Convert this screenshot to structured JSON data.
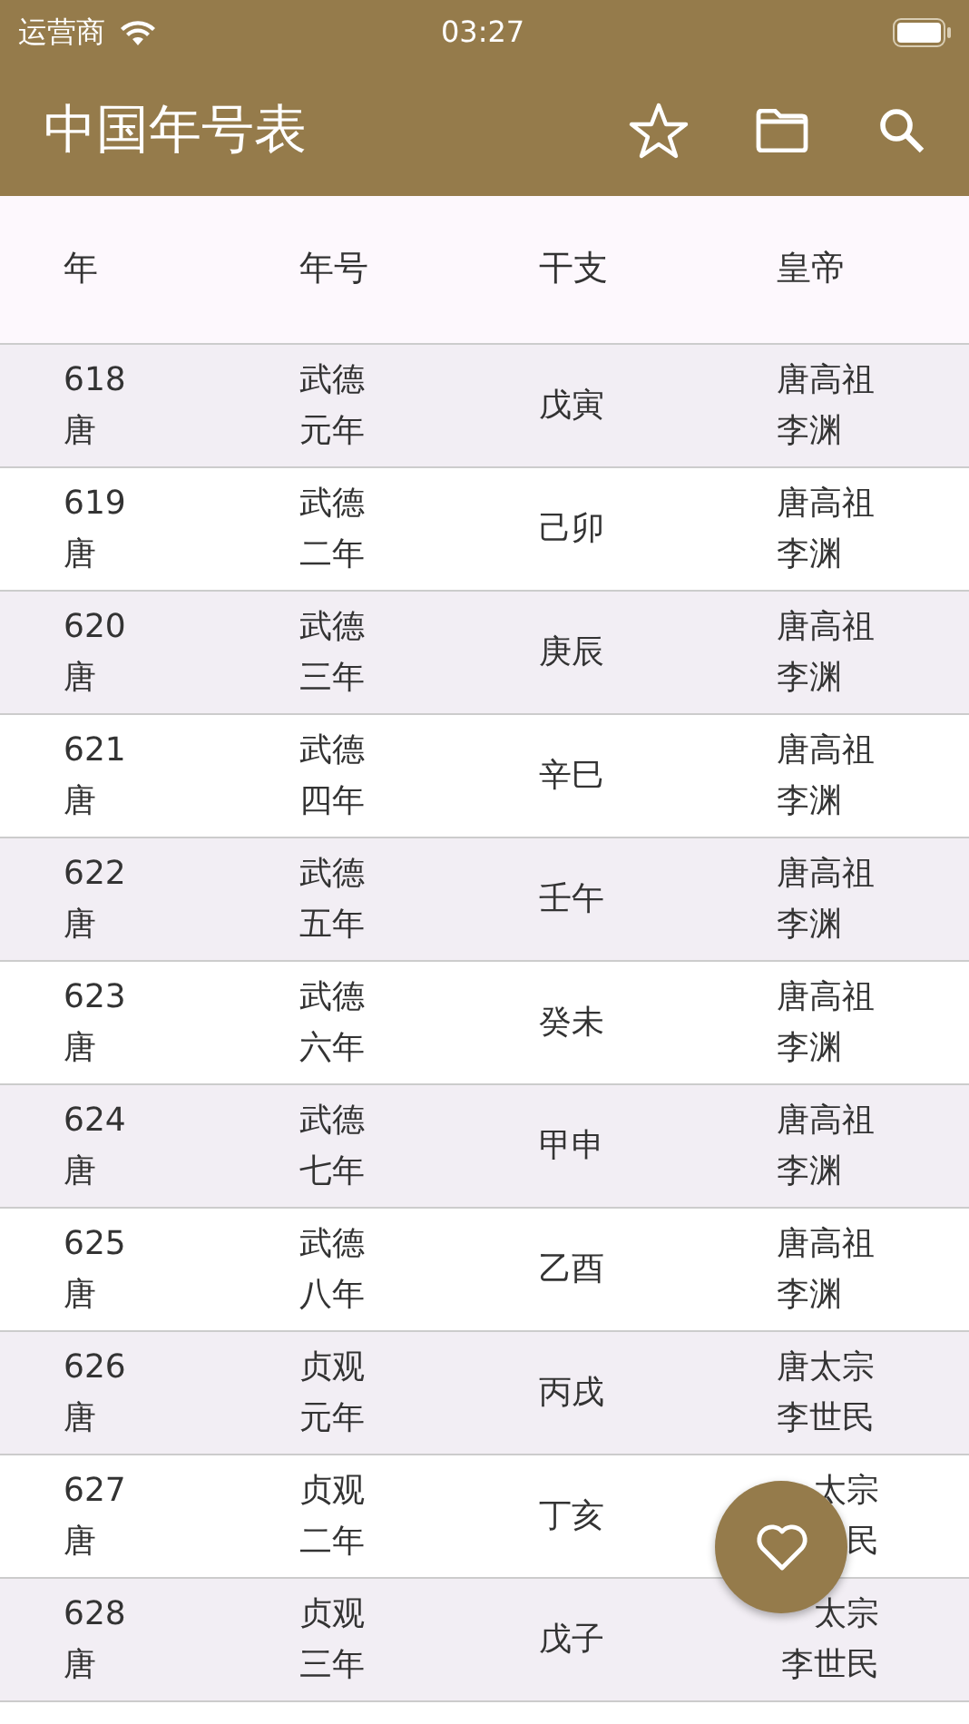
{
  "status_bar": {
    "carrier": "运营商",
    "time": "03:27"
  },
  "app_bar": {
    "title": "中国年号表"
  },
  "table": {
    "columns": [
      "年",
      "年号",
      "干支",
      "皇帝"
    ],
    "rows": [
      {
        "year": "618",
        "dynasty": "唐",
        "era": [
          "武德",
          "元年"
        ],
        "ganzhi": "戊寅",
        "emperor": [
          "唐高祖",
          "李渊"
        ]
      },
      {
        "year": "619",
        "dynasty": "唐",
        "era": [
          "武德",
          "二年"
        ],
        "ganzhi": "己卯",
        "emperor": [
          "唐高祖",
          "李渊"
        ]
      },
      {
        "year": "620",
        "dynasty": "唐",
        "era": [
          "武德",
          "三年"
        ],
        "ganzhi": "庚辰",
        "emperor": [
          "唐高祖",
          "李渊"
        ]
      },
      {
        "year": "621",
        "dynasty": "唐",
        "era": [
          "武德",
          "四年"
        ],
        "ganzhi": "辛巳",
        "emperor": [
          "唐高祖",
          "李渊"
        ]
      },
      {
        "year": "622",
        "dynasty": "唐",
        "era": [
          "武德",
          "五年"
        ],
        "ganzhi": "壬午",
        "emperor": [
          "唐高祖",
          "李渊"
        ]
      },
      {
        "year": "623",
        "dynasty": "唐",
        "era": [
          "武德",
          "六年"
        ],
        "ganzhi": "癸未",
        "emperor": [
          "唐高祖",
          "李渊"
        ]
      },
      {
        "year": "624",
        "dynasty": "唐",
        "era": [
          "武德",
          "七年"
        ],
        "ganzhi": "甲申",
        "emperor": [
          "唐高祖",
          "李渊"
        ]
      },
      {
        "year": "625",
        "dynasty": "唐",
        "era": [
          "武德",
          "八年"
        ],
        "ganzhi": "乙酉",
        "emperor": [
          "唐高祖",
          "李渊"
        ]
      },
      {
        "year": "626",
        "dynasty": "唐",
        "era": [
          "贞观",
          "元年"
        ],
        "ganzhi": "丙戌",
        "emperor": [
          "唐太宗",
          "李世民"
        ]
      },
      {
        "year": "627",
        "dynasty": "唐",
        "era": [
          "贞观",
          "二年"
        ],
        "ganzhi": "丁亥",
        "emperor": [
          "太宗",
          "民"
        ],
        "emperor_right_aligned": true
      },
      {
        "year": "628",
        "dynasty": "唐",
        "era": [
          "贞观",
          "三年"
        ],
        "ganzhi": "戊子",
        "emperor": [
          "太宗",
          "李世民"
        ],
        "emperor_right_aligned": true
      }
    ]
  }
}
